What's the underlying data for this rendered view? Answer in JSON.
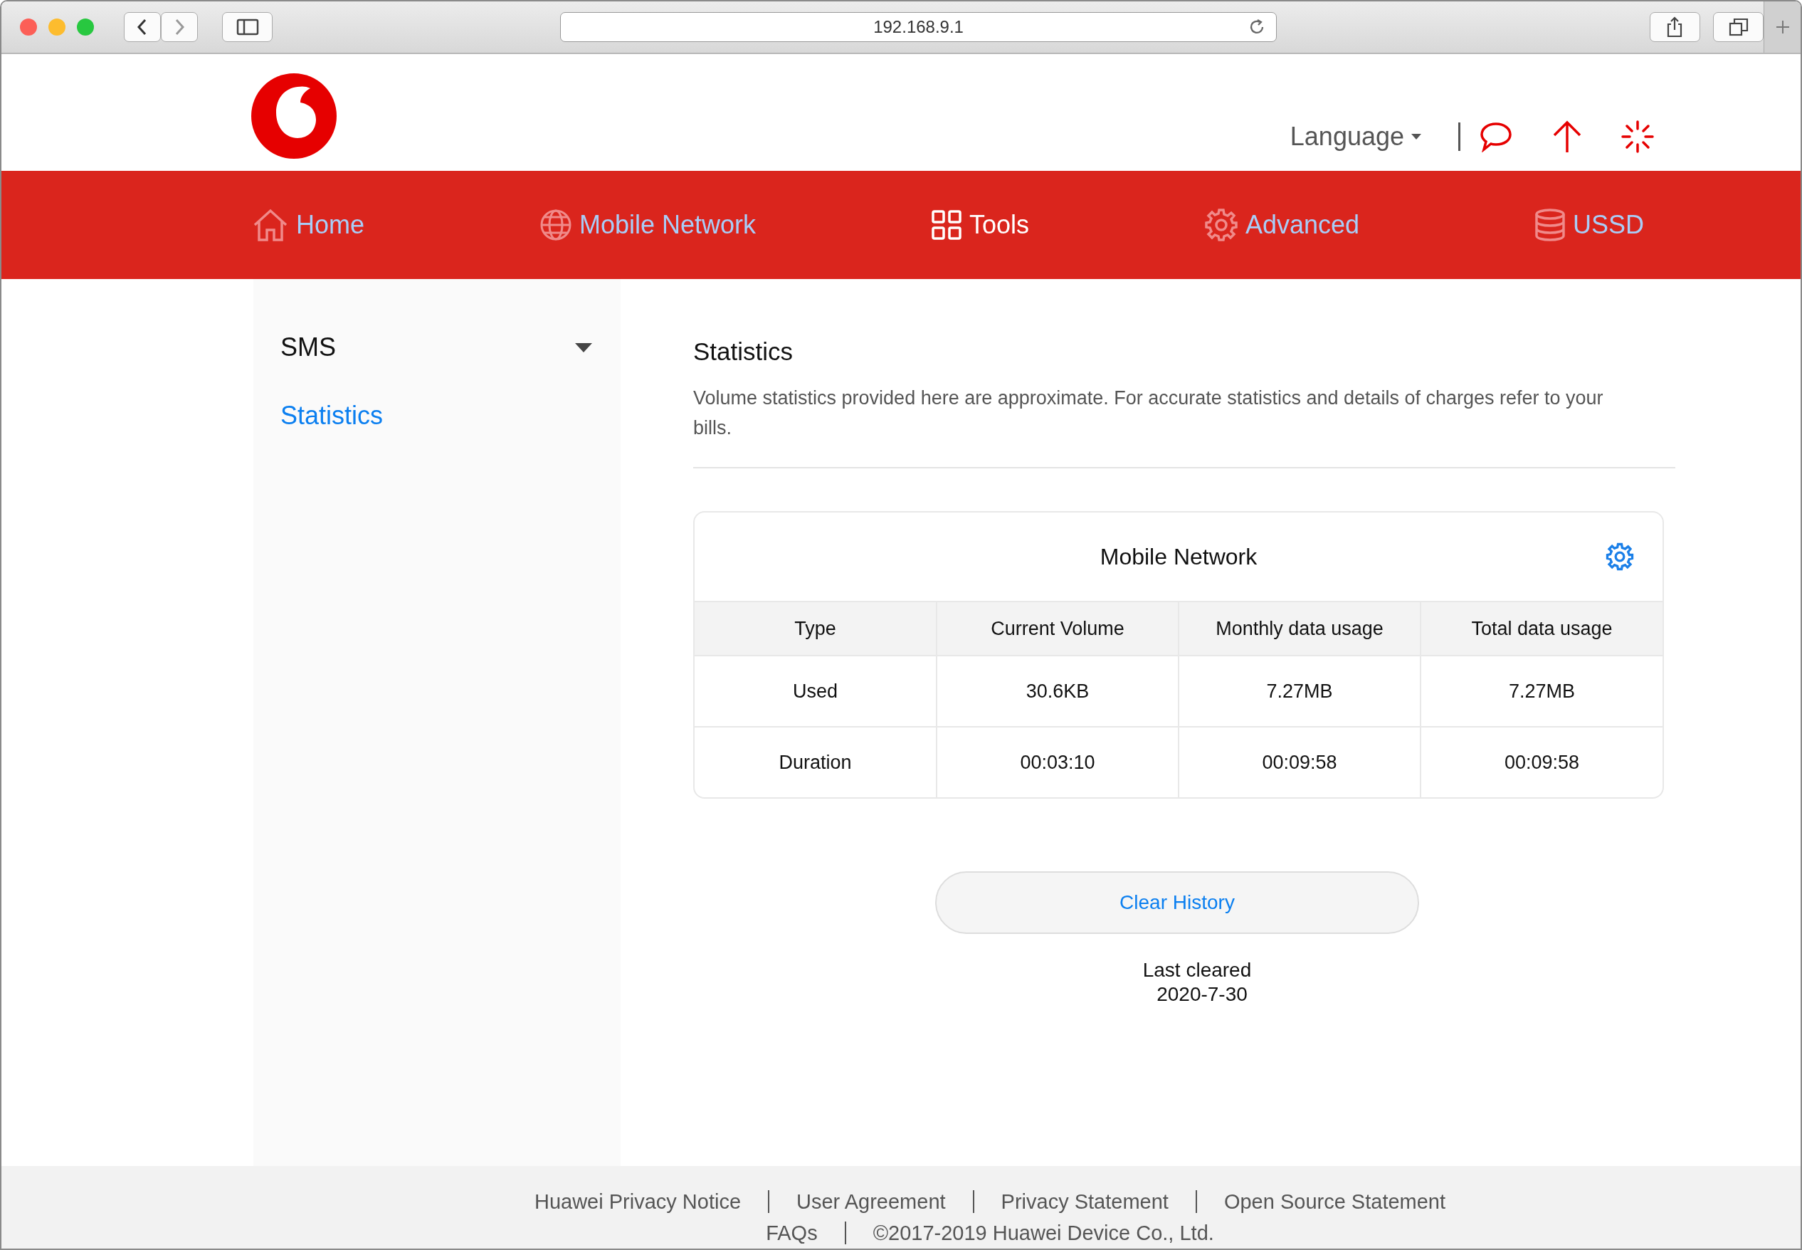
{
  "browser": {
    "address": "192.168.9.1"
  },
  "header": {
    "language": "Language"
  },
  "nav": [
    {
      "label": "Home",
      "selected": false
    },
    {
      "label": "Mobile Network",
      "selected": false
    },
    {
      "label": "Tools",
      "selected": true
    },
    {
      "label": "Advanced",
      "selected": false
    },
    {
      "label": "USSD",
      "selected": false
    }
  ],
  "sidebar": {
    "items": [
      {
        "label": "SMS",
        "kind": "group",
        "selected": false
      },
      {
        "label": "Statistics",
        "kind": "link",
        "selected": true
      }
    ]
  },
  "page": {
    "title": "Statistics",
    "description": "Volume statistics provided here are approximate. For accurate statistics and details of charges refer to your bills."
  },
  "card": {
    "title": "Mobile Network",
    "columns": [
      "Type",
      "Current Volume",
      "Monthly data usage",
      "Total data usage"
    ],
    "rows": [
      [
        "Used",
        "30.6KB",
        "7.27MB",
        "7.27MB"
      ],
      [
        "Duration",
        "00:03:10",
        "00:09:58",
        "00:09:58"
      ]
    ]
  },
  "clear_button": "Clear History",
  "last_cleared": {
    "label": "Last cleared",
    "date": "2020-7-30"
  },
  "footer": {
    "links": [
      "Huawei Privacy Notice",
      "User Agreement",
      "Privacy Statement",
      "Open Source Statement"
    ],
    "faq": "FAQs",
    "copyright": "©2017-2019 Huawei Device Co., Ltd."
  }
}
